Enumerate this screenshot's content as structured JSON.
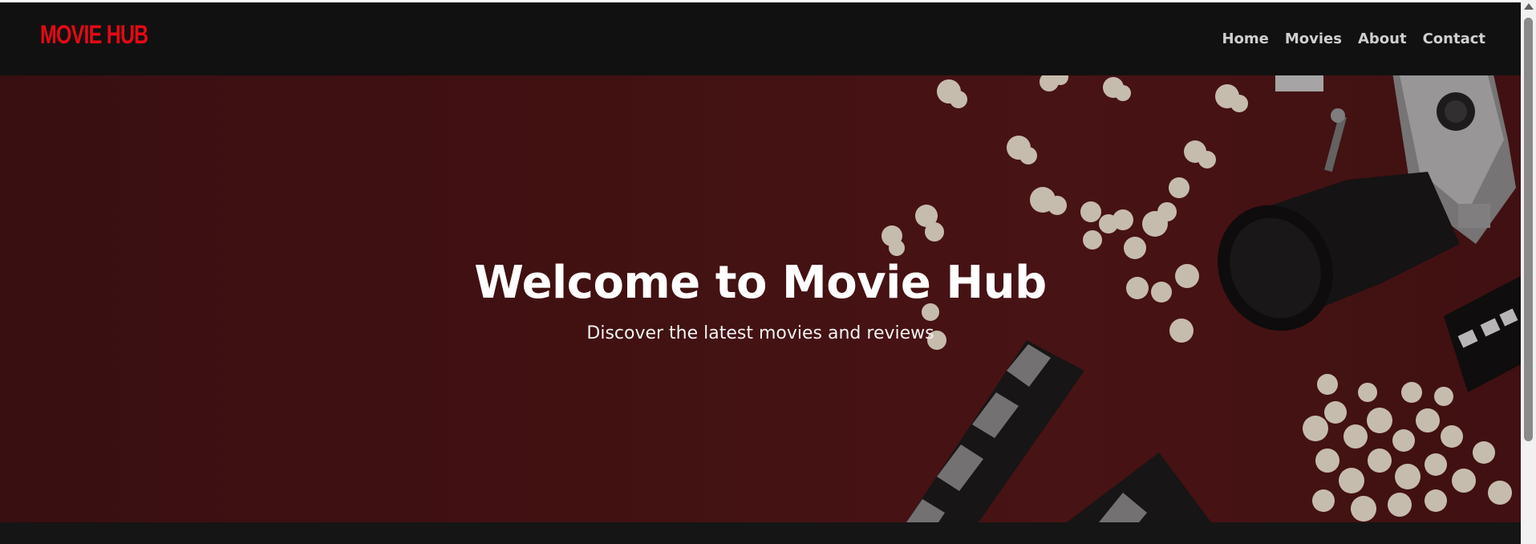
{
  "app": {
    "logo_text": "MOVIE HUB",
    "brand_color": "#e50914"
  },
  "nav": {
    "items": [
      {
        "label": "Home"
      },
      {
        "label": "Movies"
      },
      {
        "label": "About"
      },
      {
        "label": "Contact"
      }
    ]
  },
  "hero": {
    "title": "Welcome to Movie Hub",
    "subtitle": "Discover the latest movies and reviews",
    "background_description_icons": [
      "popcorn-icon",
      "film-camera-icon",
      "clapperboard-icon",
      "film-strip-icon"
    ]
  },
  "colors": {
    "nav_background": "#111111",
    "hero_background": "#4e1517",
    "text": "#ffffff"
  }
}
